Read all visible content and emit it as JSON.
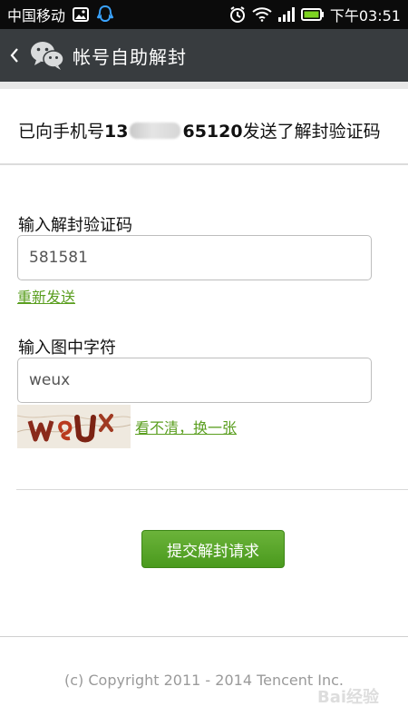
{
  "status_bar": {
    "carrier": "中国移动",
    "time": "下午03:51",
    "icons": [
      "image-icon",
      "qq-icon",
      "alarm-icon",
      "wifi-icon",
      "signal-icon",
      "battery-icon"
    ]
  },
  "title_bar": {
    "title": "帐号自助解封",
    "back_icon": "chevron-left-icon",
    "logo_icon": "wechat-icon"
  },
  "info": {
    "prefix": "已向手机号",
    "phone_start": "13",
    "phone_end": "65120",
    "suffix": "发送了解封验证码"
  },
  "form": {
    "code_label": "输入解封验证码",
    "code_value": "581581",
    "resend_link": "重新发送",
    "captcha_label": "输入图中字符",
    "captcha_value": "weux",
    "refresh_link": "看不清，换一张"
  },
  "submit": {
    "label": "提交解封请求"
  },
  "footer": {
    "copyright": "(c) Copyright 2011 - 2014 Tencent Inc."
  },
  "colors": {
    "status_bar_bg": "#0b0b0b",
    "title_bar_bg": "#383c3f",
    "link_green": "#5a9e1f",
    "button_green": "#4a9a1d"
  }
}
